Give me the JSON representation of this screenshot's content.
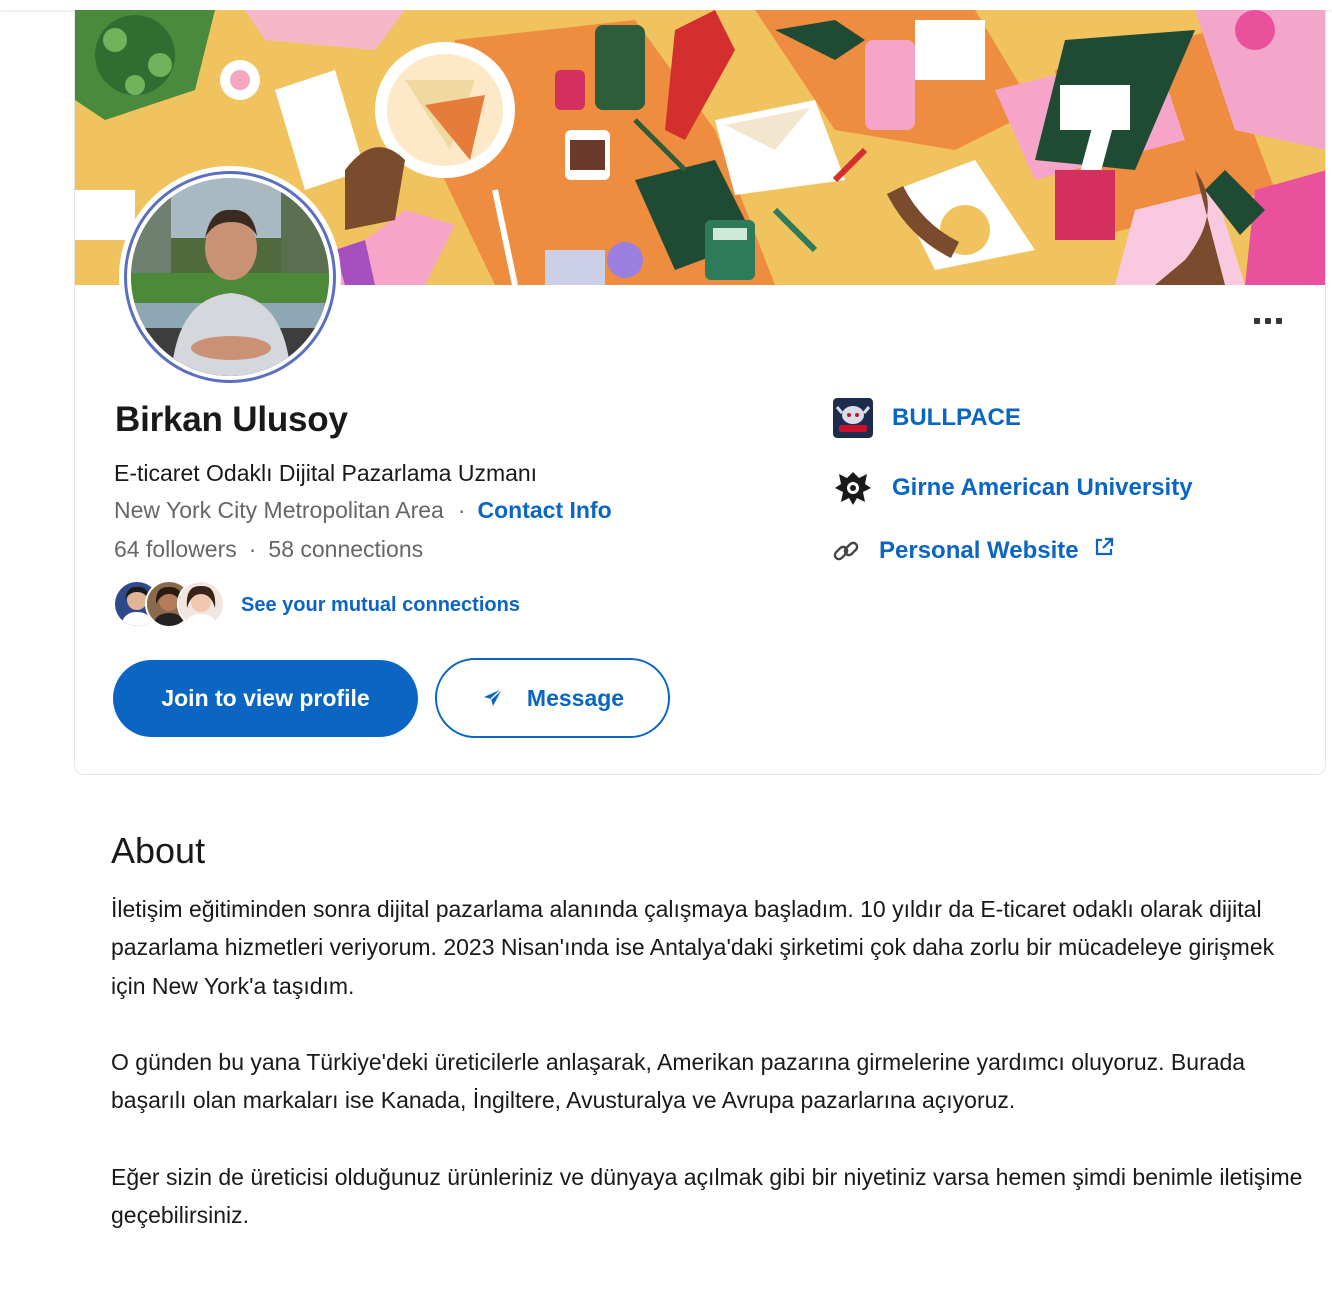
{
  "profile": {
    "name": "Birkan Ulusoy",
    "headline": "E-ticaret Odaklı Dijital Pazarlama Uzmanı",
    "location": "New York City Metropolitan Area",
    "separator": "·",
    "contact_info": "Contact Info",
    "followers": "64 followers",
    "connections": "58 connections",
    "mutual_connections": "See your mutual connections"
  },
  "actions": {
    "join": "Join to view profile",
    "message": "Message",
    "more": "More actions"
  },
  "sidebar": {
    "company": "BULLPACE",
    "school": "Girne American University",
    "website": "Personal Website"
  },
  "about": {
    "title": "About",
    "paragraphs": [
      "İletişim eğitiminden sonra dijital pazarlama alanında çalışmaya başladım. 10 yıldır da E-ticaret odaklı olarak dijital pazarlama hizmetleri veriyorum. 2023 Nisan'ında ise Antalya'daki şirketimi çok daha zorlu bir mücadeleye girişmek için New York'a taşıdım.",
      "O günden bu yana Türkiye'deki üreticilerle anlaşarak, Amerikan pazarına girmelerine yardımcı oluyoruz. Burada başarılı olan markaları ise Kanada, İngiltere, Avusturalya ve Avrupa pazarlarına açıyoruz.",
      "Eğer sizin de üreticisi olduğunuz ürünleriniz ve dünyaya açılmak gibi bir niyetiniz varsa hemen şimdi benimle iletişime geçebilirsiniz."
    ]
  },
  "colors": {
    "accent": "#0a66c2",
    "banner_base": "#f1c35e",
    "text_primary": "#191919",
    "text_secondary": "#666666"
  }
}
